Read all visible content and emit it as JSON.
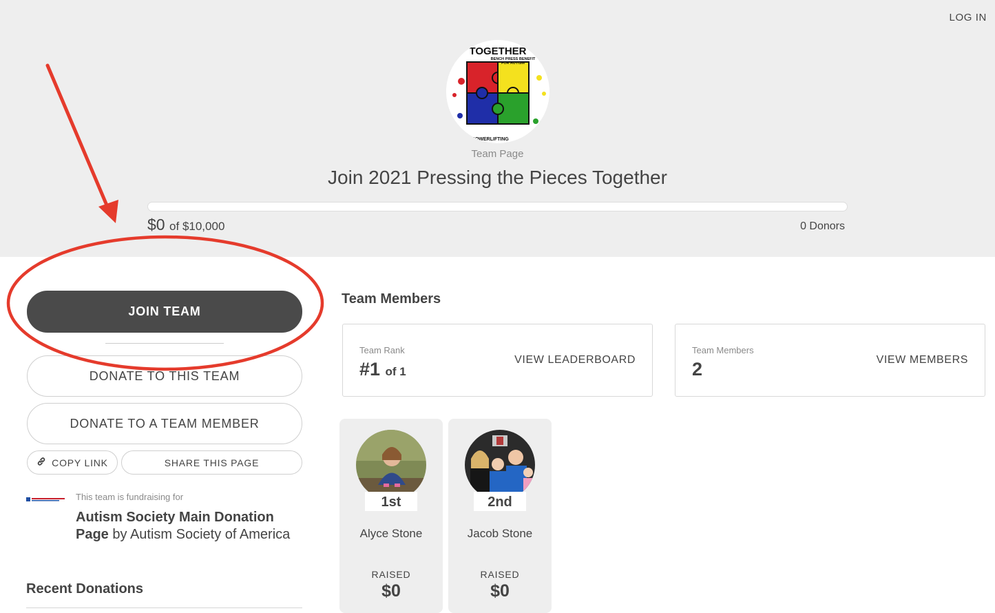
{
  "header": {
    "login_label": "LOG IN",
    "logo_text_top": "TOGETHER",
    "logo_text_sub": "BENCH PRESS BENEFIT FOR AUTISM",
    "logo_text_bottom": "POWERLIFTING",
    "page_type": "Team Page",
    "title": "Join 2021 Pressing the Pieces Together",
    "progress_fraction": 0,
    "raised_amount": "$0",
    "raised_goal": "of $10,000",
    "donors": "0 Donors"
  },
  "actions": {
    "join": "JOIN TEAM",
    "donate_team": "DONATE TO THIS TEAM",
    "donate_member": "DONATE TO A TEAM MEMBER",
    "copy_link": "COPY LINK",
    "share": "SHARE THIS PAGE"
  },
  "charity": {
    "caption": "This team is fundraising for",
    "name": "Autism Society Main Donation Page",
    "by": "by Autism Society of America"
  },
  "recent_donations": {
    "title": "Recent Donations"
  },
  "team": {
    "section_title": "Team Members",
    "rank_label": "Team Rank",
    "rank_value": "#1",
    "rank_of": "of 1",
    "leaderboard_link": "VIEW LEADERBOARD",
    "members_label": "Team Members",
    "members_value": "2",
    "members_link": "VIEW MEMBERS"
  },
  "members": [
    {
      "rank": "1st",
      "name": "Alyce Stone",
      "raised_label": "RAISED",
      "raised": "$0"
    },
    {
      "rank": "2nd",
      "name": "Jacob Stone",
      "raised_label": "RAISED",
      "raised": "$0"
    }
  ],
  "colors": {
    "hero_bg": "#eeeeee",
    "primary_button": "#4a4a4a",
    "annotation": "#e53b2c"
  }
}
